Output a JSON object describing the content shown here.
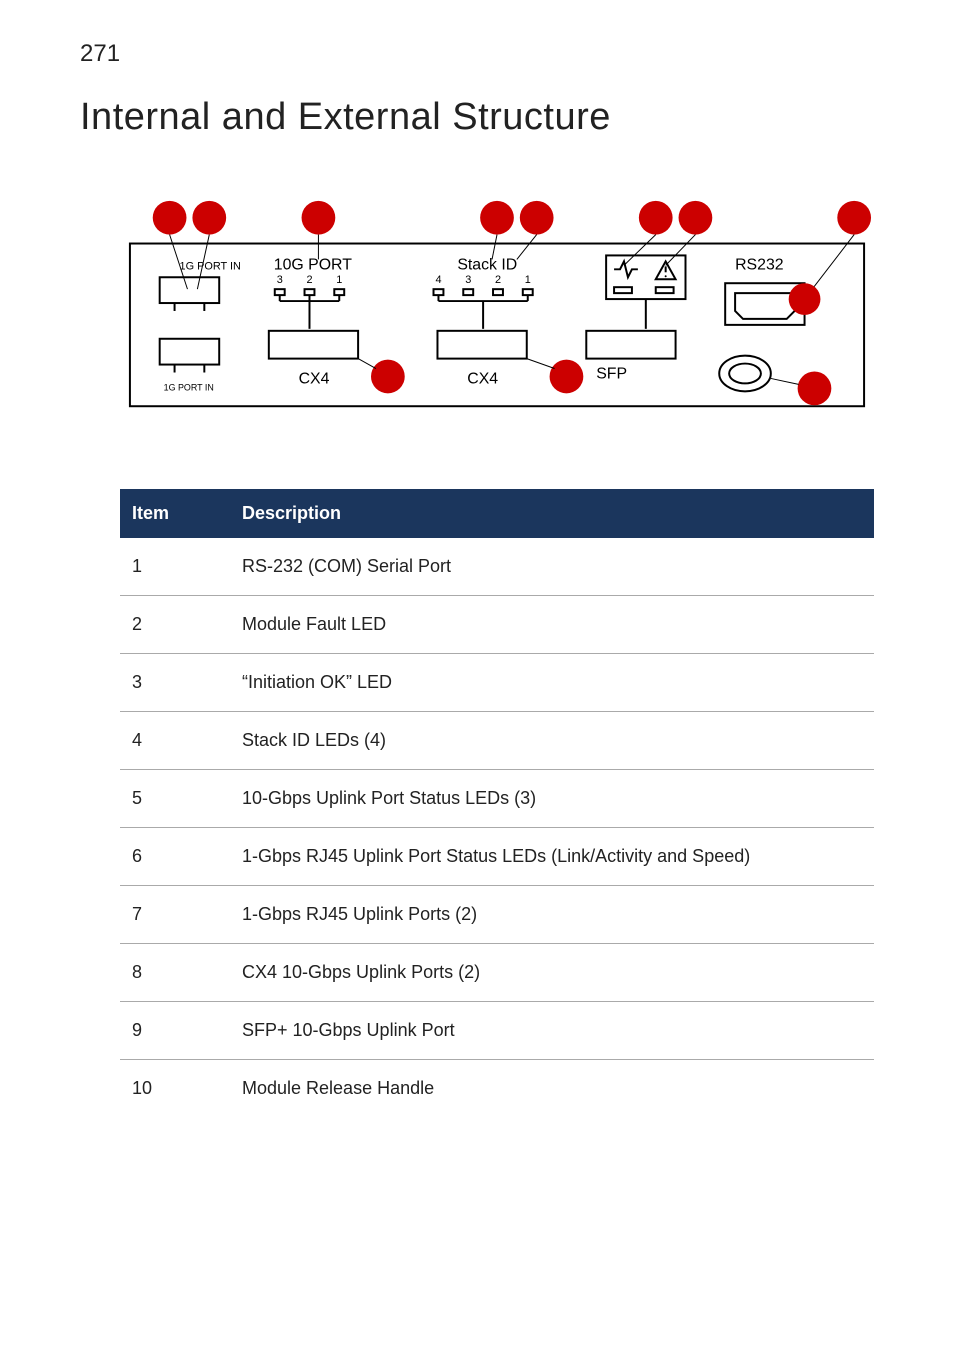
{
  "page_number": "271",
  "title": "Internal and External Structure",
  "diagram": {
    "labels": {
      "port_in_top": "1G PORT IN",
      "port_in_bottom": "1G PORT IN",
      "tenG_port": "10G PORT",
      "tenG_numbers": [
        "3",
        "2",
        "1"
      ],
      "stack_id": "Stack ID",
      "stack_numbers": [
        "4",
        "3",
        "2",
        "1"
      ],
      "rs232": "RS232",
      "cx4_left": "CX4",
      "cx4_right": "CX4",
      "sfp": "SFP"
    }
  },
  "table": {
    "headers": {
      "item": "Item",
      "description": "Description"
    },
    "rows": [
      {
        "item": "1",
        "desc": "RS-232 (COM) Serial Port"
      },
      {
        "item": "2",
        "desc": "Module Fault LED"
      },
      {
        "item": "3",
        "desc": "“Initiation OK” LED"
      },
      {
        "item": "4",
        "desc": "Stack ID LEDs (4)"
      },
      {
        "item": "5",
        "desc": "10-Gbps Uplink Port Status LEDs (3)"
      },
      {
        "item": "6",
        "desc": "1-Gbps RJ45 Uplink Port Status LEDs (Link/Activity and Speed)"
      },
      {
        "item": "7",
        "desc": "1-Gbps RJ45 Uplink Ports (2)"
      },
      {
        "item": "8",
        "desc": "CX4 10-Gbps Uplink Ports (2)"
      },
      {
        "item": "9",
        "desc": "SFP+ 10-Gbps Uplink Port"
      },
      {
        "item": "10",
        "desc": "Module Release Handle"
      }
    ]
  }
}
